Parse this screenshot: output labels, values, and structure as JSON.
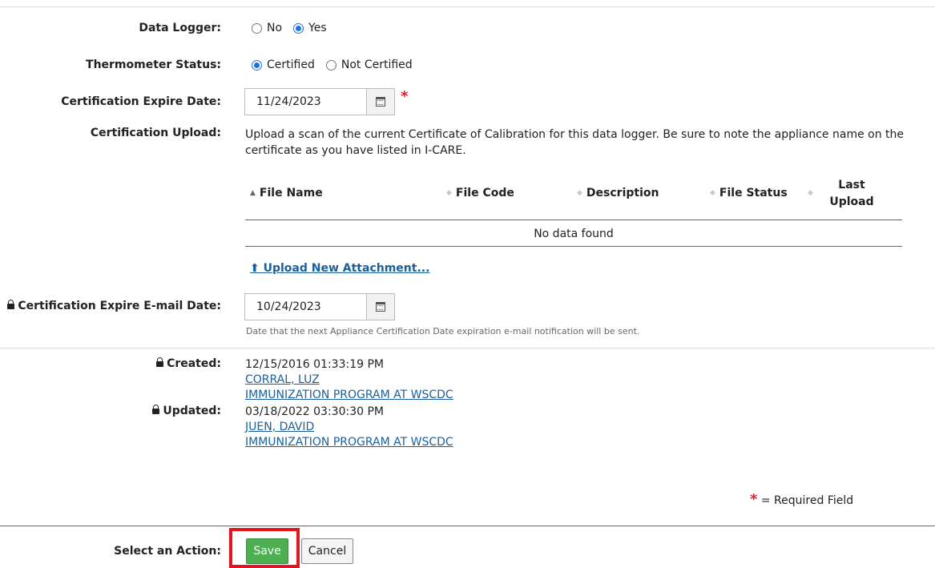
{
  "data_logger": {
    "label": "Data Logger:",
    "options": [
      "No",
      "Yes"
    ],
    "selected": "Yes"
  },
  "thermometer_status": {
    "label": "Thermometer Status:",
    "options": [
      "Certified",
      "Not Certified"
    ],
    "selected": "Certified"
  },
  "cert_expire_date": {
    "label": "Certification Expire Date:",
    "value": "11/24/2023",
    "required_mark": "*"
  },
  "cert_upload": {
    "label": "Certification Upload:",
    "help_text": "Upload a scan of the current Certificate of Calibration for this data logger. Be sure to note the appliance name on the certificate as you have listed in I-CARE.",
    "table": {
      "columns": [
        "File Name",
        "File Code",
        "Description",
        "File Status",
        "Last Upload"
      ],
      "empty_text": "No data found"
    },
    "upload_link": "Upload New Attachment..."
  },
  "cert_email_date": {
    "label": "Certification Expire E-mail Date:",
    "value": "10/24/2023",
    "help_text": "Date that the next Appliance Certification Date expiration e-mail notification will be sent."
  },
  "created": {
    "label": "Created:",
    "timestamp": "12/15/2016 01:33:19 PM",
    "user": "CORRAL, LUZ",
    "org": "IMMUNIZATION PROGRAM AT WSCDC"
  },
  "updated": {
    "label": "Updated:",
    "timestamp": "03/18/2022 03:30:30 PM",
    "user": "JUEN, DAVID",
    "org": "IMMUNIZATION PROGRAM AT WSCDC"
  },
  "required_legend": {
    "mark": "*",
    "text": "= Required Field"
  },
  "actions": {
    "label": "Select an Action:",
    "save": "Save",
    "cancel": "Cancel"
  },
  "colors": {
    "accent": "#1a73e8",
    "link": "#1a5f9c",
    "save": "#4caf50",
    "required": "#d9232e",
    "highlight": "#e4151e"
  }
}
